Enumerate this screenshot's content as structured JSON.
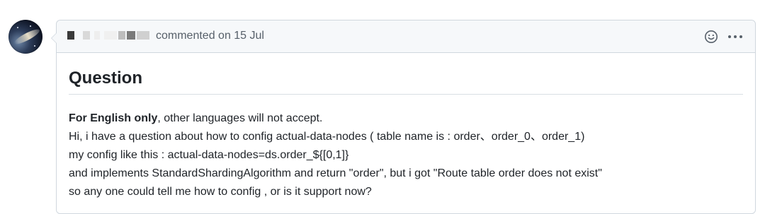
{
  "comment": {
    "meta_text": "commented on 15 Jul",
    "heading": "Question",
    "body": {
      "lead_bold": "For English only",
      "lead_rest": ", other languages will not accept.",
      "lines": [
        "Hi, i have a question about how to config actual-data-nodes ( table name is : order、order_0、order_1)",
        "my config like this : actual-data-nodes=ds.order_${[0,1]}",
        "and implements StandardShardingAlgorithm and return \"order\", but i got \"Route table order does not exist\"",
        "so any one could tell me how to config , or is it support now?"
      ]
    },
    "icons": {
      "avatar": "galaxy-avatar",
      "reaction": "smiley-icon",
      "more": "kebab-horizontal-icon"
    }
  }
}
